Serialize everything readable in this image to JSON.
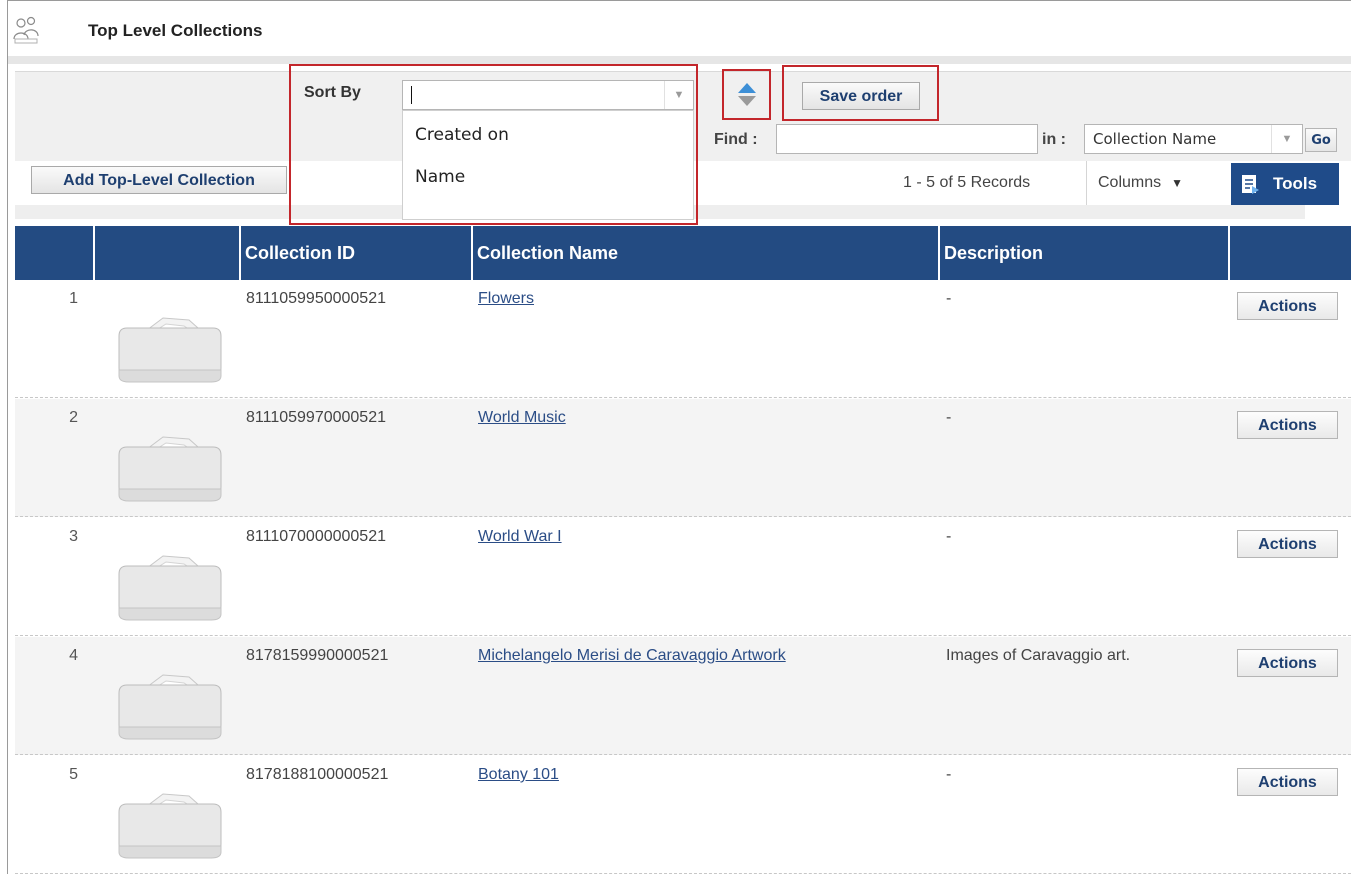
{
  "header": {
    "title": "Top Level Collections",
    "icon": "people-icon"
  },
  "sort": {
    "label": "Sort By",
    "value": "",
    "options": [
      "Created on",
      "Name"
    ],
    "direction_icon": "sort-up-down-icon",
    "save_label": "Save order"
  },
  "find": {
    "label": "Find :",
    "value": "",
    "in_label": "in :",
    "in_value": "Collection Name",
    "go_label": "Go"
  },
  "toolbar": {
    "add_label": "Add Top-Level Collection",
    "records_text": "1 - 5 of 5 Records",
    "columns_label": "Columns",
    "tools_label": "Tools"
  },
  "table": {
    "headers": [
      "",
      "",
      "Collection ID",
      "Collection Name",
      "Description",
      ""
    ],
    "rows": [
      {
        "num": "1",
        "id": "8111059950000521",
        "name": "Flowers",
        "desc": "-",
        "action": "Actions"
      },
      {
        "num": "2",
        "id": "8111059970000521",
        "name": "World Music",
        "desc": "-",
        "action": "Actions"
      },
      {
        "num": "3",
        "id": "8111070000000521",
        "name": "World War I",
        "desc": "-",
        "action": "Actions"
      },
      {
        "num": "4",
        "id": "8178159990000521",
        "name": "Michelangelo Merisi de Caravaggio Artwork",
        "desc": "Images of Caravaggio art.",
        "action": "Actions"
      },
      {
        "num": "5",
        "id": "8178188100000521",
        "name": "Botany 101",
        "desc": "-",
        "action": "Actions"
      }
    ]
  },
  "colors": {
    "header_bg": "#234b82",
    "highlight": "#c3262b",
    "link": "#2b4d86"
  }
}
